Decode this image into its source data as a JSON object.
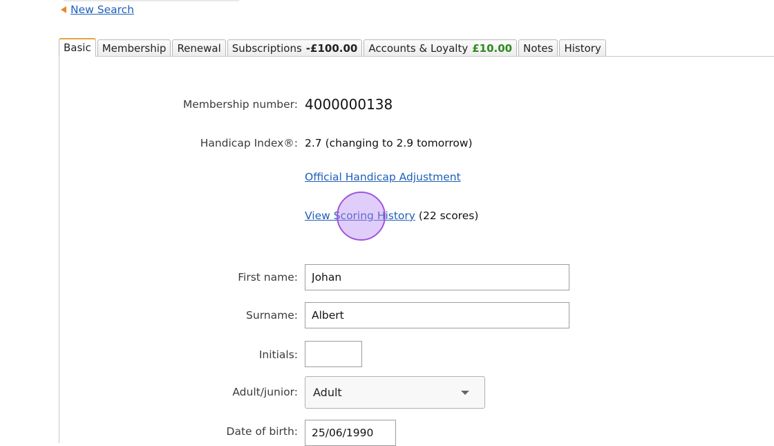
{
  "nav": {
    "new_search_label": "New Search"
  },
  "tabs": [
    {
      "label": "Basic",
      "active": true
    },
    {
      "label": "Membership"
    },
    {
      "label": "Renewal"
    },
    {
      "label": "Subscriptions",
      "amount": "-£100.00"
    },
    {
      "label": "Accounts & Loyalty",
      "amount": "£10.00"
    },
    {
      "label": "Notes"
    },
    {
      "label": "History"
    }
  ],
  "basic": {
    "membership_number_label": "Membership number:",
    "membership_number": "4000000138",
    "handicap_label": "Handicap Index®:",
    "handicap_value": "2.7 (changing to 2.9 tomorrow)",
    "official_adjustment_link": "Official Handicap Adjustment",
    "scoring_history_link": "View Scoring History",
    "scores_count": "(22 scores)",
    "first_name_label": "First name:",
    "first_name": "Johan",
    "surname_label": "Surname:",
    "surname": "Albert",
    "initials_label": "Initials:",
    "initials": "",
    "adult_junior_label": "Adult/junior:",
    "adult_junior": "Adult",
    "dob_label": "Date of birth:",
    "dob": "25/06/1990"
  },
  "colors": {
    "link": "#1f5fb8",
    "positive_amount": "#2e8a1e",
    "active_tab_accent": "#e8a33d",
    "click_indicator": "#9b55e0"
  }
}
